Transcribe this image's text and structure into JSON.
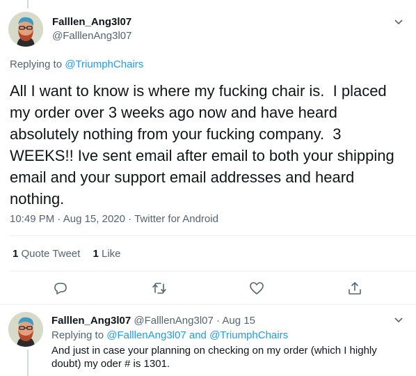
{
  "tweet": {
    "display_name": "Falllen_Ang3l07",
    "handle": "@FalllenAng3l07",
    "replying_prefix": "Replying to ",
    "replying_to": "@TriumphChairs",
    "text": "All I want to know is where my fucking chair is.  I placed my order over 3 weeks ago now and have heard absolutely nothing from your fucking company.  3 WEEKS!! Ive sent email after email to both your shipping email and your support email addresses and heard nothing.",
    "time": "10:49 PM",
    "date": "Aug 15, 2020",
    "source": "Twitter for Android",
    "sep": "·"
  },
  "stats": {
    "quote_count": "1",
    "quote_label": "Quote Tweet",
    "like_count": "1",
    "like_label": "Like"
  },
  "actions": [
    "reply-icon",
    "retweet-icon",
    "like-icon",
    "share-icon"
  ],
  "reply": {
    "display_name": "Falllen_Ang3l07",
    "handle": "@FalllenAng3l07",
    "sep": "·",
    "date": "Aug 15",
    "replying_prefix": "Replying to ",
    "replying_to_1": "@FalllenAng3l07",
    "and": " and ",
    "replying_to_2": "@TriumphChairs",
    "text": "And just in case your planning on checking on my order (which I highly doubt) my oder # is 1301."
  },
  "colors": {
    "link": "#1d9bf0",
    "muted": "#536471",
    "text": "#0f1419"
  }
}
